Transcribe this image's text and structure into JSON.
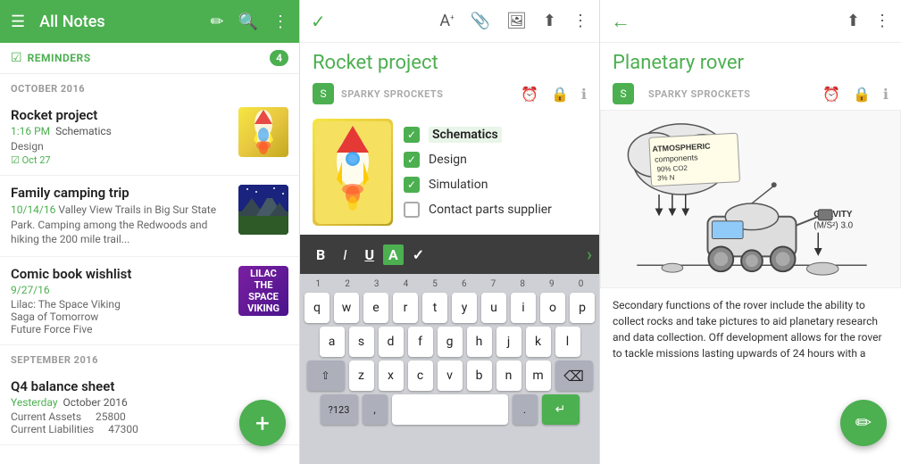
{
  "panel1": {
    "header": {
      "title": "All Notes",
      "menu_icon": "☰",
      "new_note_icon": "✏",
      "search_icon": "🔍",
      "more_icon": "⋮"
    },
    "reminders": {
      "label": "REMINDERS",
      "badge": "4"
    },
    "section_october": "OCTOBER 2016",
    "notes": [
      {
        "title": "Rocket project",
        "meta": "1:16 PM  Schematics",
        "sub": "Design",
        "date": "Oct 27",
        "date_icon": "☑",
        "thumb_type": "rocket"
      },
      {
        "title": "Family camping trip",
        "meta": "10/14/16  Valley View Trails in Big Sur State Park. Camping among the Redwoods and hiking the 200 mile trail...",
        "thumb_type": "camping"
      },
      {
        "title": "Comic book wishlist",
        "meta": "9/27/16",
        "lines": [
          "Lilac: The Space Viking",
          "Saga of Tomorrow",
          "Future Force Five"
        ],
        "thumb_type": "comic"
      }
    ],
    "section_september": "SEPTEMBER 2016",
    "q4_note": {
      "title": "Q4 balance sheet",
      "meta": "Yesterday  October 2016",
      "line1_label": "Current Assets",
      "line1_value": "25800",
      "line2_label": "Current Liabilities",
      "line2_value": "47300"
    },
    "fab_icon": "+"
  },
  "panel2": {
    "header": {
      "check_icon": "✓",
      "format_icon": "A",
      "attach_icon": "📎",
      "image_icon": "🖼",
      "share_icon": "⋮"
    },
    "title": "Rocket project",
    "notebook": "SPARKY SPROCKETS",
    "checklist": [
      {
        "checked": true,
        "text": "Schematics",
        "active": true
      },
      {
        "checked": true,
        "text": "Design"
      },
      {
        "checked": true,
        "text": "Simulation"
      },
      {
        "checked": false,
        "text": "Contact parts supplier"
      }
    ],
    "toolbar": {
      "bold": "B",
      "italic": "I",
      "underline": "U",
      "color": "A",
      "check": "✓"
    },
    "keyboard": {
      "numbers_row": [
        "1",
        "2",
        "3",
        "4",
        "5",
        "6",
        "7",
        "8",
        "9",
        "0"
      ],
      "row1": [
        "q",
        "w",
        "e",
        "r",
        "t",
        "y",
        "u",
        "i",
        "o",
        "p"
      ],
      "row2": [
        "a",
        "s",
        "d",
        "f",
        "g",
        "h",
        "j",
        "k",
        "l"
      ],
      "row3": [
        "z",
        "x",
        "c",
        "v",
        "b",
        "n",
        "m"
      ],
      "bottom_left": "?123",
      "comma": ",",
      "space": "",
      "period": ".",
      "enter": "↵"
    }
  },
  "panel3": {
    "header": {
      "back_icon": "←",
      "share_icon": "⋮"
    },
    "title": "Planetary rover",
    "notebook": "SPARKY SPROCKETS",
    "description": "Secondary functions of the rover include the ability to collect rocks and take pictures to aid planetary research and data collection. Off development allows for the rover to tackle missions lasting upwards of 24 hours with a",
    "fab_icon": "✏"
  }
}
